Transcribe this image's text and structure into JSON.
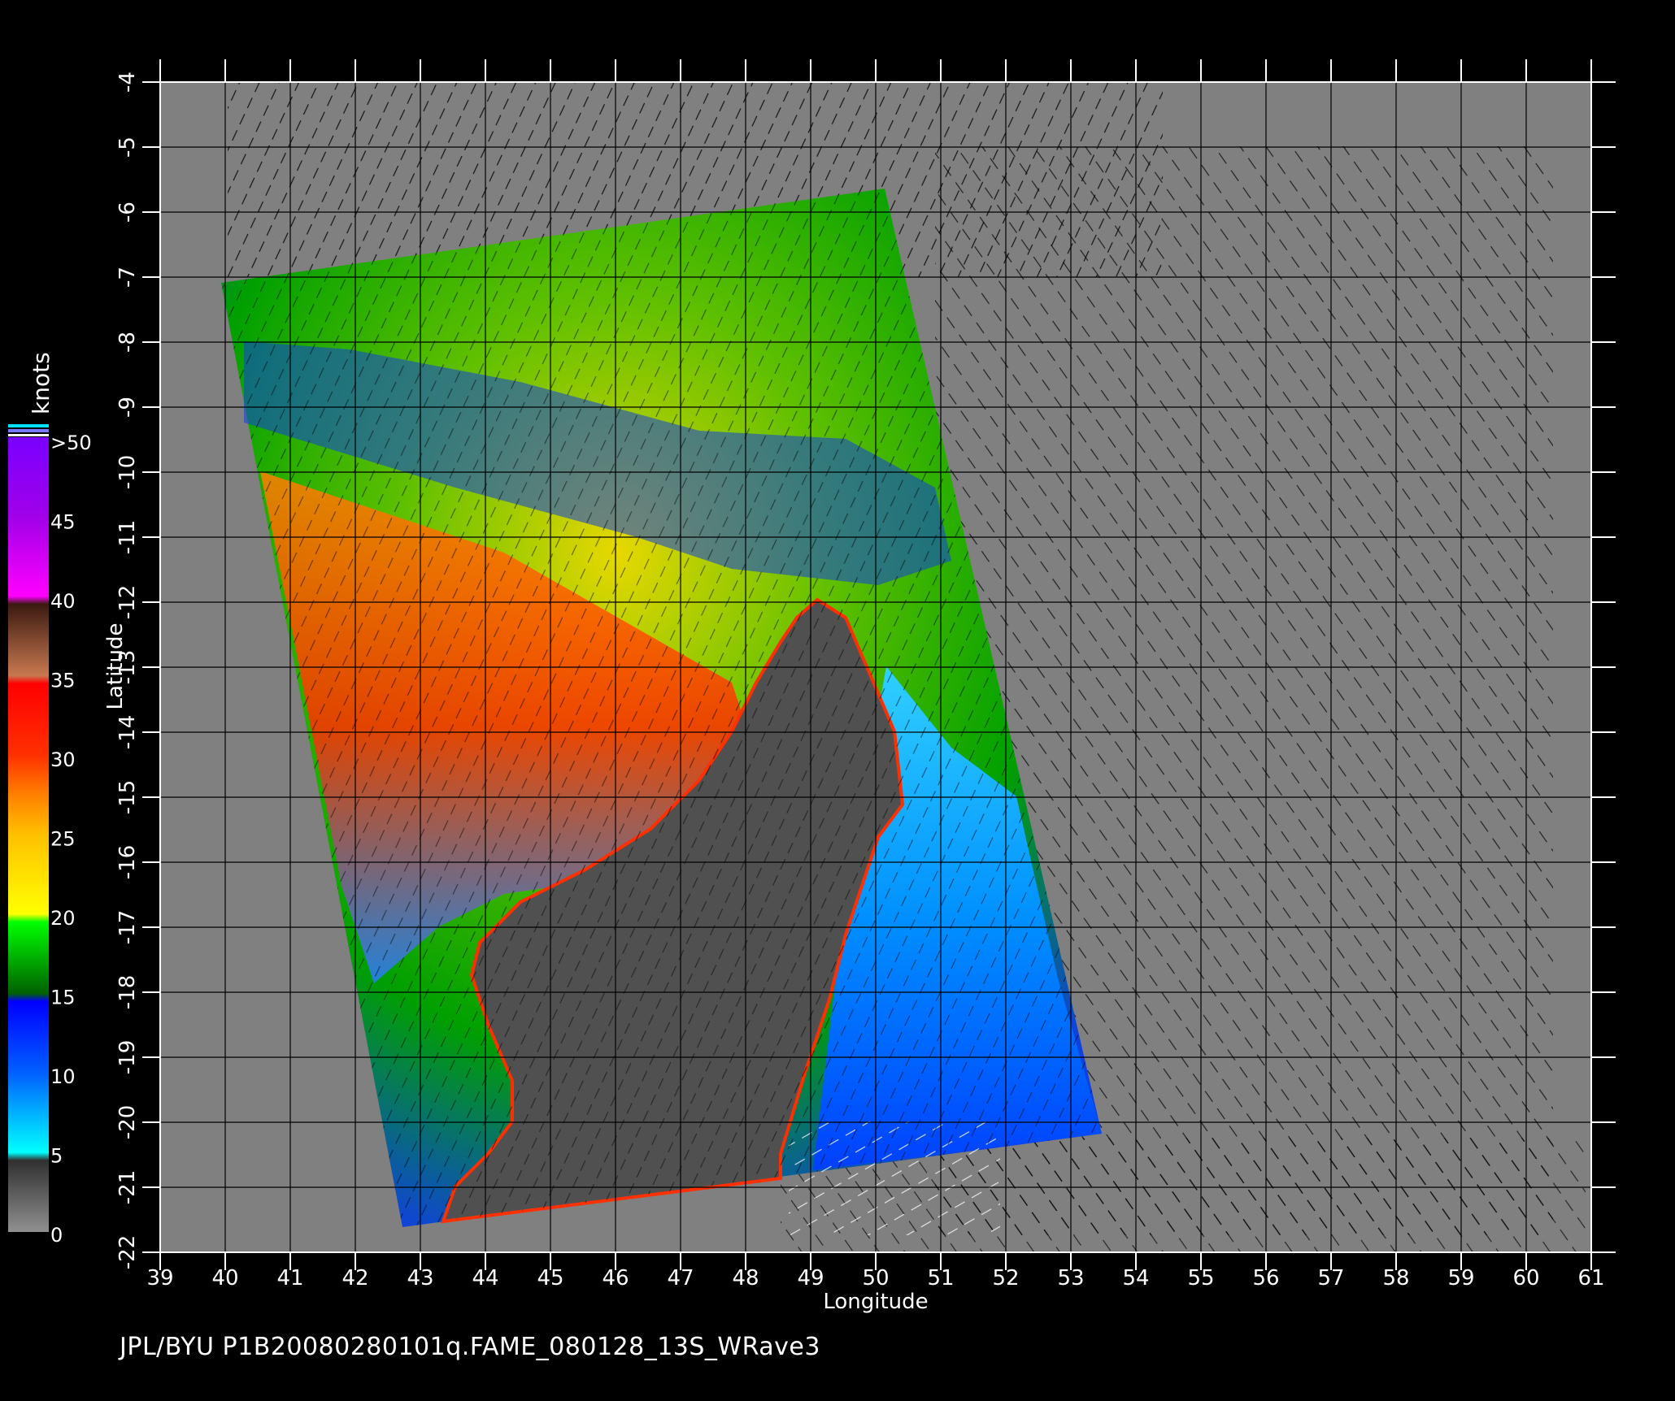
{
  "map": {
    "x_axis_label": "Longitude",
    "y_axis_label": "Latitude",
    "x_ticks": [
      "39",
      "40",
      "41",
      "42",
      "43",
      "44",
      "45",
      "46",
      "47",
      "48",
      "49",
      "50",
      "51",
      "52",
      "53",
      "54",
      "55",
      "56",
      "57",
      "58",
      "59",
      "60",
      "61"
    ],
    "y_ticks": [
      "-4",
      "-5",
      "-6",
      "-7",
      "-8",
      "-9",
      "-10",
      "-11",
      "-12",
      "-13",
      "-14",
      "-15",
      "-16",
      "-17",
      "-18",
      "-19",
      "-20",
      "-21",
      "-22"
    ],
    "background_color": "#808080",
    "land_color": "#505050",
    "grid_color": "#000000"
  },
  "colorbar": {
    "unit": "knots",
    "labels": [
      ">50",
      "45",
      "40",
      "35",
      "30",
      "25",
      "20",
      "15",
      "10",
      "5",
      "0"
    ],
    "colors": [
      "#7a00ff",
      "#c000e0",
      "#ff00ff",
      "#6b2a1a",
      "#ff0000",
      "#ff6000",
      "#ffe000",
      "#00c000",
      "#0000ff",
      "#00ffff",
      "#606060"
    ]
  },
  "footer": {
    "caption": "JPL/BYU  P1B20080280101q.FAME_080128_13S_WRave3"
  }
}
